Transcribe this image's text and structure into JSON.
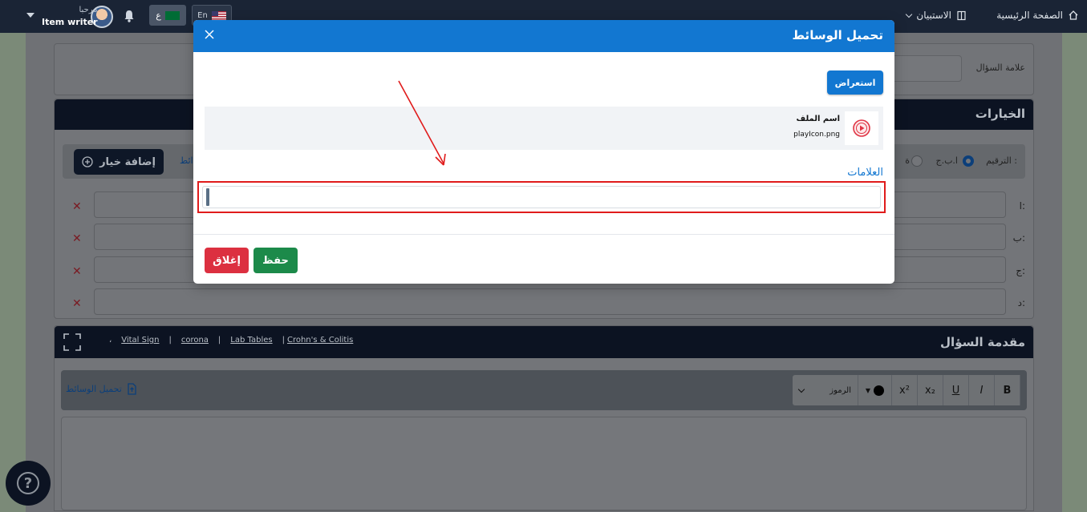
{
  "topbar": {
    "home_label": "الصفحة الرئيسية",
    "exam_label": "الاستبيان",
    "lang_en": "En",
    "lang_ar": "ع",
    "greeting": "مرحبا",
    "user_name": "Item writer"
  },
  "background": {
    "question_mark_label": "علامة السؤال",
    "options_card": {
      "title": "الخيارات",
      "numbering_label": "الترقيم :",
      "numbering_option_1": "ا.ب.ج",
      "numbering_option_2": "ة",
      "add_option_label": "إضافة خيار",
      "partial_label": "ائط",
      "rows": [
        {
          "letter": "ا:"
        },
        {
          "letter": "ب:"
        },
        {
          "letter": "ج:"
        },
        {
          "letter": "د:"
        }
      ]
    },
    "intro_card": {
      "title": "مقدمة السؤال",
      "links": [
        "Vital Sign",
        "corona",
        "Lab Tables",
        "Crohn's & Colitis"
      ],
      "symbols_label": "الرموز",
      "upload_media_label": "تحميل الوسائط",
      "toolbar_buttons": [
        "B",
        "I",
        "U",
        "x₂",
        "x²"
      ]
    }
  },
  "modal": {
    "title": "تحميل الوسائط",
    "browse_label": "استعراض",
    "file_name_label": "اسم الملف",
    "file_name": "playIcon.png",
    "tags_label": "العلامات",
    "tags_value": "",
    "save_label": "حفظ",
    "close_label": "إغلاق"
  },
  "colors": {
    "primary": "#1277d1",
    "navbar": "#1a2435",
    "save": "#1c8a4a",
    "close": "#dc3040",
    "highlight": "#e01b1b"
  }
}
